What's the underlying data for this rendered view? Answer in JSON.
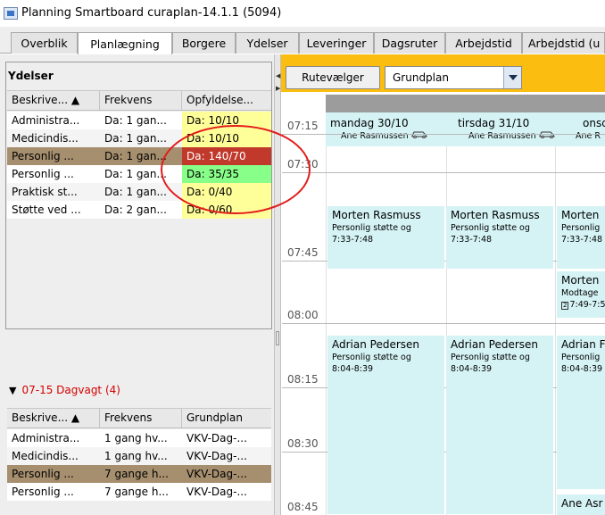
{
  "window": {
    "title": "Planning Smartboard curaplan-14.1.1 (5094)"
  },
  "tabs": [
    {
      "label": "Overblik",
      "active": false
    },
    {
      "label": "Planlægning",
      "active": true
    },
    {
      "label": "Borgere",
      "active": false
    },
    {
      "label": "Ydelser",
      "active": false
    },
    {
      "label": "Leveringer",
      "active": false
    },
    {
      "label": "Dagsruter",
      "active": false
    },
    {
      "label": "Arbejdstid",
      "active": false
    },
    {
      "label": "Arbejdstid (u",
      "active": false
    }
  ],
  "left_panel": {
    "section_title": "Ydelser",
    "top_table": {
      "columns": [
        "Beskrive... ▲",
        "Frekvens",
        "Opfyldelse..."
      ],
      "rows": [
        {
          "cells": [
            "Administra...",
            "Da: 1 gan...",
            "Da: 10/10"
          ],
          "status_color": "#ffff99",
          "row_bg": "#ffffff"
        },
        {
          "cells": [
            "Medicindis...",
            "Da: 1 gan...",
            "Da: 10/10"
          ],
          "status_color": "#ffff99",
          "row_bg": "#f4f4f4"
        },
        {
          "cells": [
            "Personlig ...",
            "Da: 1 gan...",
            "Da: 140/70"
          ],
          "status_color": "#c0392b",
          "row_bg": "#a68f6e",
          "status_text_color": "#ffffff"
        },
        {
          "cells": [
            "Personlig ...",
            "Da: 1 gan...",
            "Da: 35/35"
          ],
          "status_color": "#88ff88",
          "row_bg": "#ffffff"
        },
        {
          "cells": [
            "Praktisk st...",
            "Da: 1 gan...",
            "Da: 0/40"
          ],
          "status_color": "#ffff99",
          "row_bg": "#f4f4f4"
        },
        {
          "cells": [
            "Støtte ved ...",
            "Da: 2 gan...",
            "Da: 0/60"
          ],
          "status_color": "#ffff99",
          "row_bg": "#ffffff"
        }
      ]
    },
    "shift_header": "07-15 Dagvagt (4)",
    "bottom_table": {
      "columns": [
        "Beskrive... ▲",
        "Frekvens",
        "Grundplan"
      ],
      "rows": [
        {
          "cells": [
            "Administra...",
            "1 gang hv...",
            "VKV-Dag-..."
          ],
          "row_bg": "#ffffff"
        },
        {
          "cells": [
            "Medicindis...",
            "1 gang hv...",
            "VKV-Dag-..."
          ],
          "row_bg": "#f4f4f4"
        },
        {
          "cells": [
            "Personlig ...",
            "7 gange h...",
            "VKV-Dag-..."
          ],
          "row_bg": "#a68f6e"
        },
        {
          "cells": [
            "Personlig ...",
            "7 gange h...",
            "VKV-Dag-..."
          ],
          "row_bg": "#ffffff"
        }
      ]
    }
  },
  "toolbar": {
    "route_button": "Rutevælger",
    "plan_select": "Grundplan",
    "bg_color": "#fbbd0f"
  },
  "schedule": {
    "times": [
      "07:15",
      "07:30",
      "07:45",
      "08:00",
      "08:15",
      "08:30",
      "08:45"
    ],
    "days": [
      {
        "name": "mandag 30/10",
        "person": "Ane Rasmussen"
      },
      {
        "name": "tirsdag 31/10",
        "person": "Ane Rasmussen"
      },
      {
        "name": "onsd",
        "person": "Ane R"
      }
    ],
    "appointments": [
      {
        "name": "Morten Rasmuss",
        "desc": "Personlig støtte og",
        "time": "7:33-7:48"
      },
      {
        "name": "Morten Rasmuss",
        "desc": "Personlig støtte og",
        "time": "7:33-7:48"
      },
      {
        "name": "Morten",
        "desc": "Personlig",
        "time": "7:33-7:48"
      },
      {
        "name": "Morten",
        "desc": "Modtage",
        "time": "7:49-7:5",
        "badge": "2"
      },
      {
        "name": "Adrian Pedersen",
        "desc": "Personlig støtte og",
        "time": "8:04-8:39"
      },
      {
        "name": "Adrian Pedersen",
        "desc": "Personlig støtte og",
        "time": "8:04-8:39"
      },
      {
        "name": "Adrian F",
        "desc": "Personlig",
        "time": "8:04-8:39"
      },
      {
        "name": "Ane Asr",
        "desc": "",
        "time": ""
      }
    ],
    "appointment_color": "#d5f3f5"
  },
  "icons": {
    "app": "app-window-icon",
    "car": "car-icon",
    "sort": "sort-ascending-icon",
    "collapse": "triangle-down-icon",
    "dropdown": "chevron-down-icon"
  }
}
